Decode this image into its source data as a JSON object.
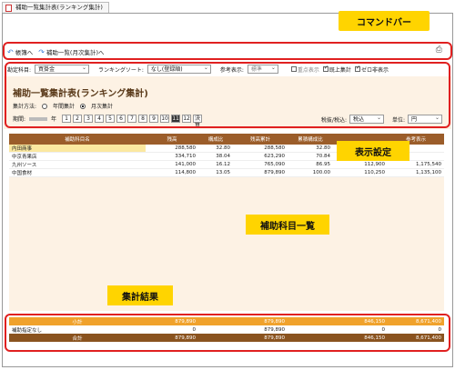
{
  "tab": {
    "title": "補助一覧集計表(ランキング集計)"
  },
  "toolbar": {
    "back_label": "帳簿へ",
    "next_label": "補助一覧(月次集計)へ"
  },
  "filters": {
    "account_label": "勘定科目:",
    "account_value": "買掛金",
    "ranking_label": "ランキングソート:",
    "ranking_value": "なし(登録順)",
    "reference_label": "参考表示:",
    "reference_value": "標準",
    "opt_priority": "重点表示",
    "opt_upper": "既上集計",
    "opt_zero": "ゼロ非表示"
  },
  "header": {
    "title": "補助一覧集計表(ランキング集計)",
    "method_label": "集計方法:",
    "method_year": "年間集計",
    "method_month": "月次集計",
    "period_label": "期間:",
    "year_suffix": "年",
    "months": [
      "1",
      "2",
      "3",
      "4",
      "5",
      "6",
      "7",
      "8",
      "9",
      "10",
      "11",
      "12",
      "決算"
    ],
    "active_month": "11",
    "tax_label": "税抜/税込:",
    "tax_value": "税込",
    "unit_label": "単位:",
    "unit_value": "円"
  },
  "table": {
    "columns": [
      "補助科目名",
      "残高",
      "構成比",
      "残高累計",
      "累積構成比",
      "",
      "参考表示"
    ],
    "rows": [
      {
        "name": "内田商事",
        "bal": "288,580",
        "ratio": "32.80",
        "cum": "288,580",
        "cumratio": "32.80",
        "c6": "",
        "c7": ""
      },
      {
        "name": "中京青果店",
        "bal": "334,710",
        "ratio": "38.04",
        "cum": "623,290",
        "cumratio": "70.84",
        "c6": "",
        "c7": ""
      },
      {
        "name": "九州ソース",
        "bal": "141,000",
        "ratio": "16.12",
        "cum": "765,090",
        "cumratio": "86.95",
        "c6": "112,900",
        "c7": "1,175,540"
      },
      {
        "name": "中国食材",
        "bal": "114,800",
        "ratio": "13.05",
        "cum": "879,890",
        "cumratio": "100.00",
        "c6": "110,250",
        "c7": "1,135,100"
      }
    ]
  },
  "totals": {
    "subtotal": {
      "name": "小計",
      "bal": "879,890",
      "cum": "879,890",
      "c6": "846,150",
      "c7": "8,671,400"
    },
    "designated": {
      "name": "補助指定なし",
      "bal": "0",
      "cum": "879,890",
      "c6": "0",
      "c7": "0"
    },
    "total": {
      "name": "合計",
      "bal": "879,890",
      "cum": "879,890",
      "c6": "846,150",
      "c7": "8,671,400"
    }
  },
  "callouts": {
    "command_bar": "コマンドバー",
    "display_settings": "表示設定",
    "subaccount_list": "補助科目一覧",
    "aggregate_result": "集計結果"
  }
}
